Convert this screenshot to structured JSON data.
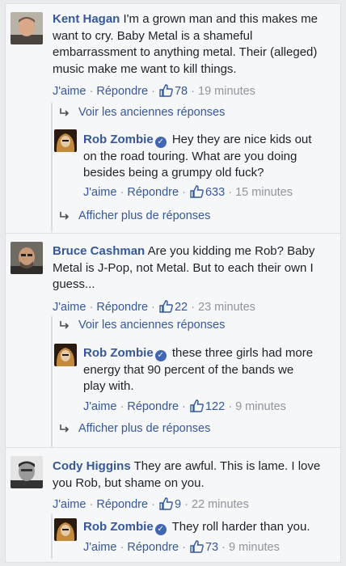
{
  "threads": [
    {
      "author": "Kent Hagan",
      "text_lines": [
        "I'm a grown man and this makes me",
        "want to cry. Baby Metal is a shameful",
        "embarrassment to anything metal. Their (alleged)",
        "music make me want to kill things."
      ],
      "like_label": "J'aime",
      "reply_label": "Répondre",
      "likes": "78",
      "time": "19 minutes",
      "previous_label": "Voir les anciennes réponses",
      "reply": {
        "author": "Rob Zombie",
        "text_lines": [
          "Hey they are nice kids out",
          "on the road touring. What are you doing",
          "besides being a grumpy old fuck?"
        ],
        "like_label": "J'aime",
        "reply_label": "Répondre",
        "likes": "633",
        "time": "15 minutes"
      },
      "more_label": "Afficher plus de réponses"
    },
    {
      "author": "Bruce Cashman",
      "text_lines": [
        "Are you kidding me Rob? Baby",
        "Metal is J-Pop, not Metal. But to each their own I",
        "guess..."
      ],
      "like_label": "J'aime",
      "reply_label": "Répondre",
      "likes": "22",
      "time": "23 minutes",
      "previous_label": "Voir les anciennes réponses",
      "reply": {
        "author": "Rob Zombie",
        "text_lines": [
          "these three girls had more",
          "energy that 90 percent of the bands we",
          "play with."
        ],
        "like_label": "J'aime",
        "reply_label": "Répondre",
        "likes": "122",
        "time": "9 minutes"
      },
      "more_label": "Afficher plus de réponses"
    },
    {
      "author": "Cody Higgins",
      "text_lines": [
        "They are awful. This is lame. I love",
        "you Rob, but shame on you."
      ],
      "like_label": "J'aime",
      "reply_label": "Répondre",
      "likes": "9",
      "time": "22 minutes",
      "reply": {
        "author": "Rob Zombie",
        "text_lines": [
          "They roll harder than you."
        ],
        "like_label": "J'aime",
        "reply_label": "Répondre",
        "likes": "73",
        "time": "9 minutes"
      }
    }
  ],
  "separator": "·",
  "colors": {
    "link": "#365899",
    "meta": "#90949c",
    "text": "#1d2129",
    "verified": "#4267b2"
  }
}
